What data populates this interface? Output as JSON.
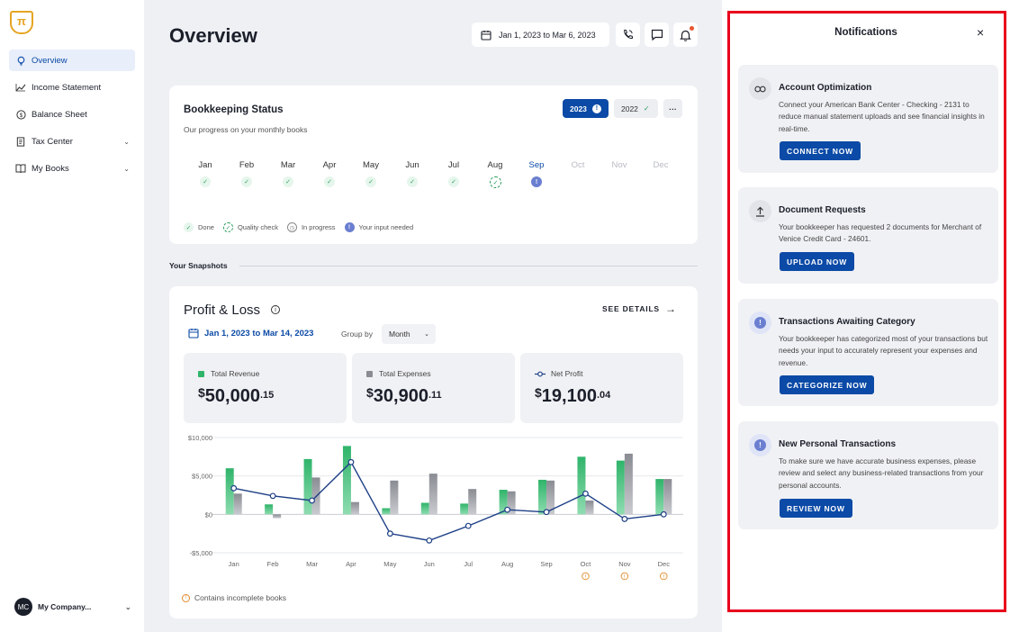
{
  "app": {
    "logo_glyph": "π"
  },
  "sidebar": {
    "items": [
      {
        "label": "Overview",
        "icon": "lightbulb-icon",
        "active": true
      },
      {
        "label": "Income Statement",
        "icon": "trend-chart-icon"
      },
      {
        "label": "Balance Sheet",
        "icon": "dollar-circle-icon"
      },
      {
        "label": "Tax Center",
        "icon": "document-icon",
        "expandable": true
      },
      {
        "label": "My Books",
        "icon": "book-icon",
        "expandable": true
      }
    ],
    "company": {
      "initials": "MC",
      "name": "My Company..."
    }
  },
  "header": {
    "title": "Overview",
    "date_range": "Jan 1, 2023 to Mar 6, 2023"
  },
  "bookkeeping": {
    "title": "Bookkeeping Status",
    "subtitle": "Our progress on your monthly books",
    "year_active": "2023",
    "year_other": "2022",
    "more": "···",
    "months": [
      {
        "label": "Jan",
        "status": "done"
      },
      {
        "label": "Feb",
        "status": "done"
      },
      {
        "label": "Mar",
        "status": "done"
      },
      {
        "label": "Apr",
        "status": "done"
      },
      {
        "label": "May",
        "status": "done"
      },
      {
        "label": "Jun",
        "status": "done"
      },
      {
        "label": "Jul",
        "status": "done"
      },
      {
        "label": "Aug",
        "status": "quality"
      },
      {
        "label": "Sep",
        "status": "input"
      },
      {
        "label": "Oct",
        "status": "none"
      },
      {
        "label": "Nov",
        "status": "none"
      },
      {
        "label": "Dec",
        "status": "none"
      }
    ],
    "legend": {
      "done": "Done",
      "quality": "Quality check",
      "progress": "In progress",
      "input": "Your input needed"
    }
  },
  "snapshots": {
    "label": "Your Snapshots"
  },
  "profit_loss": {
    "title": "Profit & Loss",
    "see_details": "SEE DETAILS",
    "date_range": "Jan 1, 2023 to Mar 14, 2023",
    "group_by_label": "Group by",
    "group_by_value": "Month",
    "metrics": [
      {
        "label": "Total Revenue",
        "currency": "$",
        "whole": "50,000",
        "cents": ".15",
        "color": "#2fb46a"
      },
      {
        "label": "Total Expenses",
        "currency": "$",
        "whole": "30,900",
        "cents": ".11",
        "color": "#8a8c93"
      },
      {
        "label": "Net Profit",
        "currency": "$",
        "whole": "19,100",
        "cents": ".04",
        "color": "#1d3f86"
      }
    ],
    "incomplete_note": "Contains incomplete books"
  },
  "chart_data": {
    "type": "bar",
    "categories": [
      "Jan",
      "Feb",
      "Mar",
      "Apr",
      "May",
      "Jun",
      "Jul",
      "Aug",
      "Sep",
      "Oct",
      "Nov",
      "Dec"
    ],
    "series": [
      {
        "name": "Total Revenue",
        "type": "bar",
        "color": "#2fb46a",
        "values": [
          6000,
          1300,
          7200,
          8900,
          800,
          1500,
          1400,
          3200,
          4500,
          7500,
          7000,
          4600
        ]
      },
      {
        "name": "Total Expenses",
        "type": "bar",
        "color": "#8a8c93",
        "values": [
          2700,
          -500,
          4800,
          1600,
          4400,
          5300,
          3300,
          3000,
          4400,
          1800,
          7900,
          4600
        ]
      },
      {
        "name": "Net Profit",
        "type": "line",
        "color": "#1d3f86",
        "values": [
          3400,
          2400,
          1800,
          6800,
          -2500,
          -3400,
          -1500,
          600,
          300,
          2700,
          -600,
          0
        ]
      }
    ],
    "ylim": [
      -5000,
      10000
    ],
    "yticks": [
      -5000,
      0,
      5000,
      10000
    ],
    "ytick_labels": [
      "-$5,000",
      "$0",
      "$5,000",
      "$10,000"
    ],
    "incomplete_months": [
      "Oct",
      "Nov",
      "Dec"
    ],
    "grid": true
  },
  "notifications": {
    "title": "Notifications",
    "close": "×",
    "items": [
      {
        "title": "Account Optimization",
        "text": "Connect your American Bank Center - Checking - 2131 to reduce manual statement uploads and see financial insights in real-time.",
        "button": "CONNECT NOW",
        "icon": "link-icon"
      },
      {
        "title": "Document Requests",
        "text": "Your bookkeeper has requested 2 documents for Merchant of Venice Credit Card - 24601.",
        "button": "UPLOAD NOW",
        "icon": "upload-icon"
      },
      {
        "title": "Transactions Awaiting Category",
        "text": "Your bookkeeper has categorized most of your transactions but needs your input to accurately represent your expenses and revenue.",
        "button": "CATEGORIZE NOW",
        "icon": "alert-icon"
      },
      {
        "title": "New Personal Transactions",
        "text": "To make sure we have accurate business expenses, please review and select any business-related transactions from your personal accounts.",
        "button": "REVIEW NOW",
        "icon": "alert-icon"
      }
    ]
  }
}
